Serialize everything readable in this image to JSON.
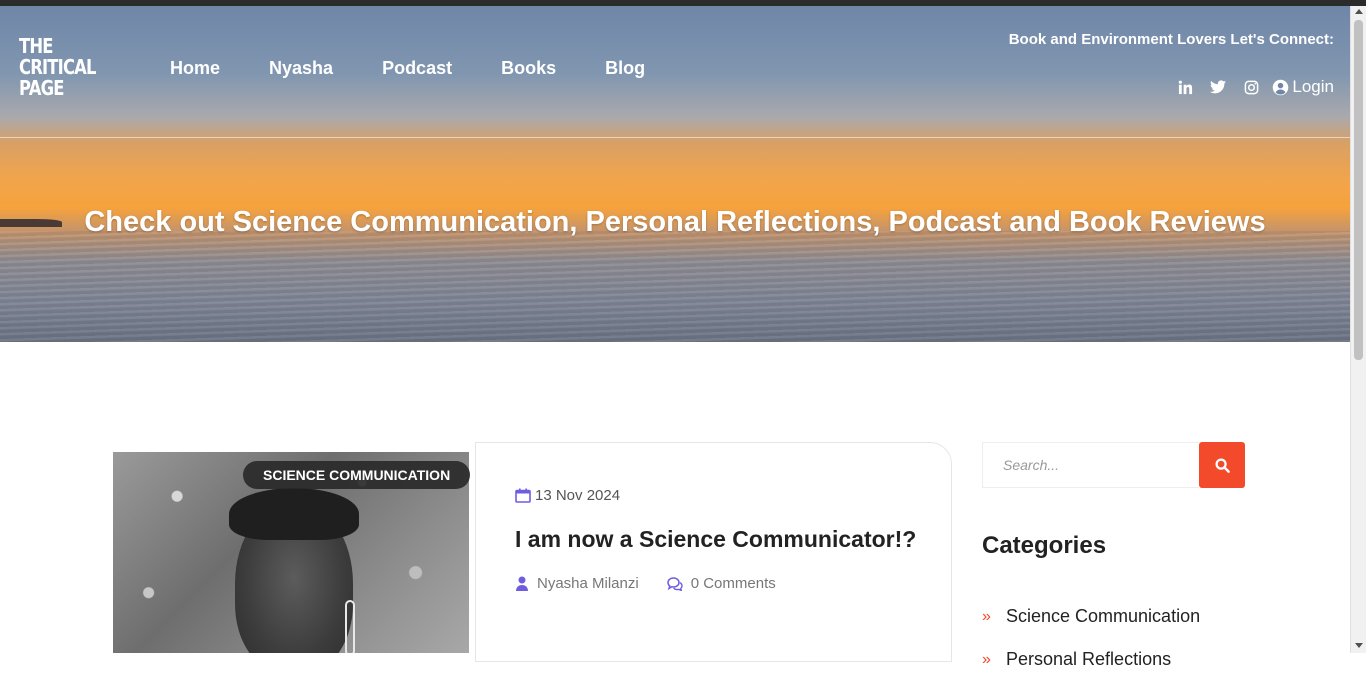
{
  "logo": {
    "line1": "THE",
    "line2": "CRITICAL",
    "line3": "PAGE"
  },
  "nav": {
    "items": [
      "Home",
      "Nyasha",
      "Podcast",
      "Books",
      "Blog"
    ]
  },
  "header": {
    "connect_text": "Book and Environment Lovers Let's Connect:",
    "login_label": "Login"
  },
  "social": [
    "linkedin-icon",
    "twitter-icon",
    "instagram-icon"
  ],
  "hero": {
    "title": "Check out Science Communication, Personal Reflections, Podcast and Book Reviews"
  },
  "post": {
    "category_badge": "SCIENCE COMMUNICATION",
    "date": "13 Nov 2024",
    "title": "I am now a Science Communicator!?",
    "author": "Nyasha Milanzi",
    "comments": "0 Comments",
    "excerpt": ""
  },
  "sidebar": {
    "search": {
      "placeholder": "Search..."
    },
    "categories": {
      "heading": "Categories",
      "items": [
        "Science Communication",
        "Personal Reflections"
      ]
    }
  },
  "colors": {
    "accent": "#f24a2b",
    "icon_purple": "#6f5de0"
  }
}
